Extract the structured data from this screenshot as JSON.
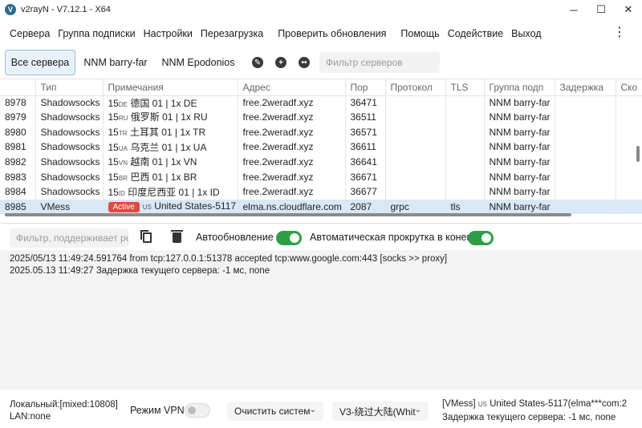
{
  "window": {
    "title": "v2rayN - V7.12.1 - X64",
    "icon": "v2rayn-app-icon"
  },
  "menu": [
    "Сервера",
    "Группа подписки",
    "Настройки",
    "Перезагрузка",
    "Проверить обновления",
    "Помощь",
    "Содействие",
    "Выход"
  ],
  "tabs": [
    "Все сервера",
    "NNM barry-far",
    "NNM Epodonios"
  ],
  "toolbar_icons": [
    "edit-icon",
    "add-icon",
    "more-icon"
  ],
  "server_filter": {
    "placeholder": "Фильтр серверов"
  },
  "table": {
    "columns": [
      "Тип",
      "Примечания",
      "Адрес",
      "Пор",
      "Протокол",
      "TLS",
      "Группа подп",
      "Задержка",
      "Ско"
    ],
    "rows": [
      {
        "id": "8978",
        "type": "Shadowsocks",
        "prefix": "15",
        "cc": "DE",
        "note": "德国 01 | 1x DE",
        "address": "free.2weradf.xyz",
        "port": "36471",
        "proto": "",
        "tls": "",
        "group": "NNM barry-far"
      },
      {
        "id": "8979",
        "type": "Shadowsocks",
        "prefix": "15",
        "cc": "RU",
        "note": "俄罗斯 01 | 1x RU",
        "address": "free.2weradf.xyz",
        "port": "36511",
        "proto": "",
        "tls": "",
        "group": "NNM barry-far"
      },
      {
        "id": "8980",
        "type": "Shadowsocks",
        "prefix": "15",
        "cc": "TR",
        "note": "土耳其 01 | 1x TR",
        "address": "free.2weradf.xyz",
        "port": "36571",
        "proto": "",
        "tls": "",
        "group": "NNM barry-far"
      },
      {
        "id": "8981",
        "type": "Shadowsocks",
        "prefix": "15",
        "cc": "UA",
        "note": "乌克兰 01 | 1x UA",
        "address": "free.2weradf.xyz",
        "port": "36611",
        "proto": "",
        "tls": "",
        "group": "NNM barry-far"
      },
      {
        "id": "8982",
        "type": "Shadowsocks",
        "prefix": "15",
        "cc": "VN",
        "note": "越南 01 | 1x VN",
        "address": "free.2weradf.xyz",
        "port": "36641",
        "proto": "",
        "tls": "",
        "group": "NNM barry-far"
      },
      {
        "id": "8983",
        "type": "Shadowsocks",
        "prefix": "15",
        "cc": "BR",
        "note": "巴西 01 | 1x BR",
        "address": "free.2weradf.xyz",
        "port": "36671",
        "proto": "",
        "tls": "",
        "group": "NNM barry-far"
      },
      {
        "id": "8984",
        "type": "Shadowsocks",
        "prefix": "15",
        "cc": "ID",
        "note": "印度尼西亚 01 | 1x ID",
        "address": "free.2weradf.xyz",
        "port": "36677",
        "proto": "",
        "tls": "",
        "group": "NNM barry-far"
      }
    ],
    "active_row": {
      "id": "8985",
      "type": "VMess",
      "badge": "Active",
      "cc": "US",
      "note": "United States-5117",
      "address": "elma.ns.cloudflare.com",
      "port": "2087",
      "proto": "grpc",
      "tls": "tls",
      "group": "NNM barry-far"
    }
  },
  "log_toolbar": {
    "filter_placeholder": "Фильтр, поддерживает рег",
    "auto_update_label": "Автообновление",
    "auto_update_on": true,
    "auto_scroll_label": "Автоматическая прокрутка в конец",
    "auto_scroll_on": true
  },
  "log": [
    "2025/05/13 11:49:24.591764 from tcp:127.0.0.1:51378 accepted tcp:www.google.com:443 [socks >> proxy]",
    "2025.05.13 11:49:27 Задержка текущего сервера: -1 мс, none"
  ],
  "status": {
    "local": "Локальный:[mixed:10808]",
    "lan": "LAN:none",
    "vpn_label": "Режим VPN",
    "vpn_on": false,
    "clear_system": "Очистить систем",
    "routing": "V3-绕过大陆(Whit",
    "server_prefix": "[VMess]",
    "server_cc": "US",
    "server_name": "United States-5117(elma***com:2",
    "delay": "Задержка текущего сервера: -1 мс, none"
  },
  "colors": {
    "accent_toggle": "#2e9e46",
    "active_badge": "#e5483d",
    "selected_row": "#d9e8f6"
  }
}
